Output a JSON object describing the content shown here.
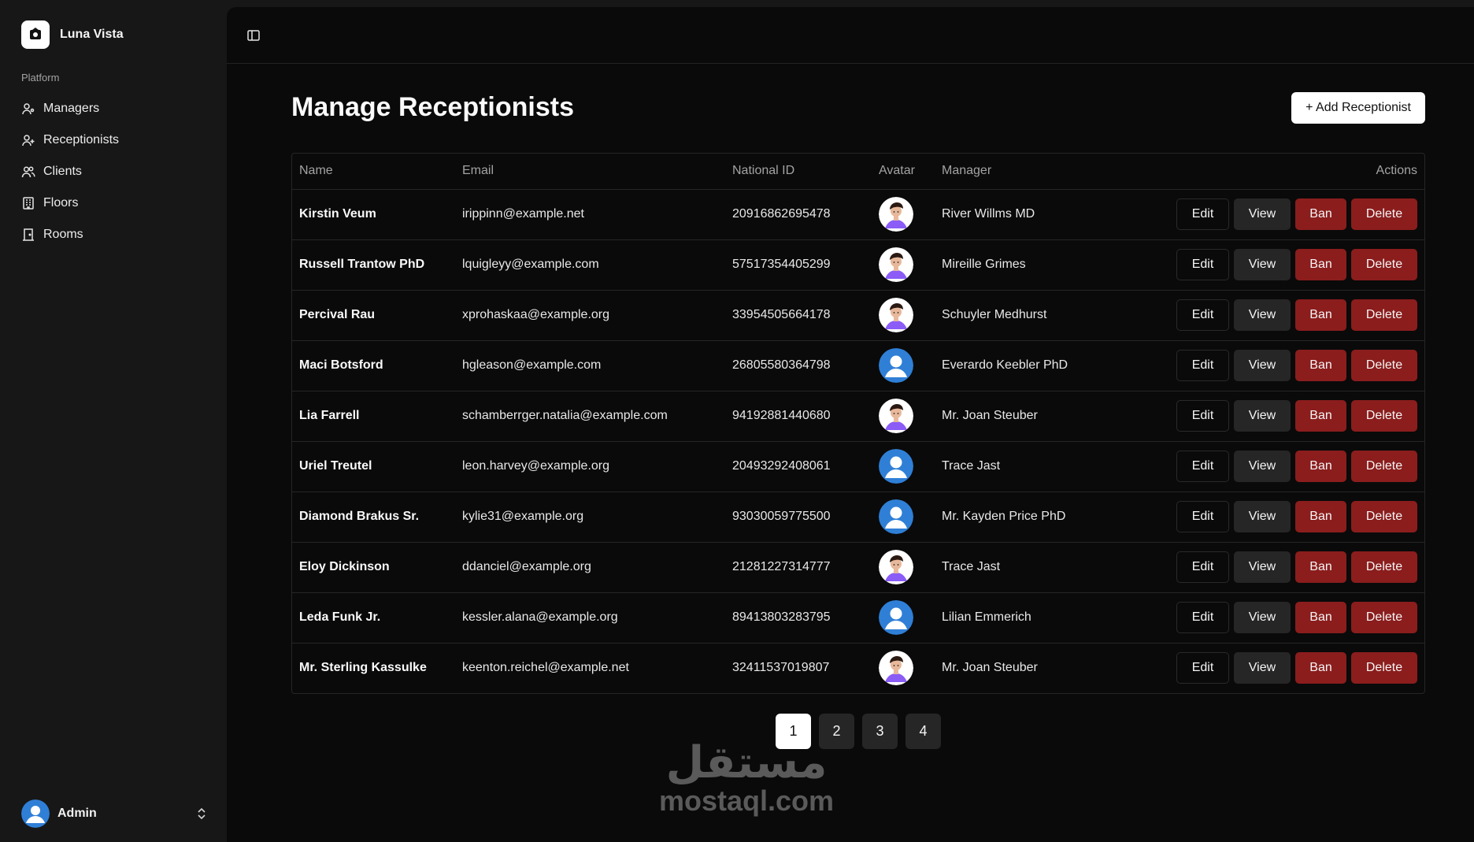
{
  "brand": {
    "name": "Luna Vista"
  },
  "sidebar": {
    "section_label": "Platform",
    "items": [
      {
        "label": "Managers",
        "icon": "user-icon"
      },
      {
        "label": "Receptionists",
        "icon": "user-plus-icon"
      },
      {
        "label": "Clients",
        "icon": "users-icon"
      },
      {
        "label": "Floors",
        "icon": "building-icon"
      },
      {
        "label": "Rooms",
        "icon": "door-icon"
      }
    ],
    "user": {
      "name": "Admin"
    }
  },
  "main": {
    "title": "Manage Receptionists",
    "add_button": "+ Add Receptionist",
    "columns": [
      "Name",
      "Email",
      "National ID",
      "Avatar",
      "Manager",
      "Actions"
    ],
    "actions": {
      "edit": "Edit",
      "view": "View",
      "ban": "Ban",
      "delete": "Delete"
    },
    "rows": [
      {
        "name": "Kirstin Veum",
        "email": "irippinn@example.net",
        "national_id": "20916862695478",
        "avatar": "cartoon",
        "manager": "River Willms MD"
      },
      {
        "name": "Russell Trantow PhD",
        "email": "lquigleyy@example.com",
        "national_id": "57517354405299",
        "avatar": "cartoon",
        "manager": "Mireille Grimes"
      },
      {
        "name": "Percival Rau",
        "email": "xprohaskaa@example.org",
        "national_id": "33954505664178",
        "avatar": "cartoon",
        "manager": "Schuyler Medhurst"
      },
      {
        "name": "Maci Botsford",
        "email": "hgleason@example.com",
        "national_id": "26805580364798",
        "avatar": "default",
        "manager": "Everardo Keebler PhD"
      },
      {
        "name": "Lia Farrell",
        "email": "schamberrger.natalia@example.com",
        "national_id": "94192881440680",
        "avatar": "cartoon",
        "manager": "Mr. Joan Steuber"
      },
      {
        "name": "Uriel Treutel",
        "email": "leon.harvey@example.org",
        "national_id": "20493292408061",
        "avatar": "default",
        "manager": "Trace Jast"
      },
      {
        "name": "Diamond Brakus Sr.",
        "email": "kylie31@example.org",
        "national_id": "93030059775500",
        "avatar": "default",
        "manager": "Mr. Kayden Price PhD"
      },
      {
        "name": "Eloy Dickinson",
        "email": "ddanciel@example.org",
        "national_id": "21281227314777",
        "avatar": "cartoon",
        "manager": "Trace Jast"
      },
      {
        "name": "Leda Funk Jr.",
        "email": "kessler.alana@example.org",
        "national_id": "89413803283795",
        "avatar": "default",
        "manager": "Lilian Emmerich"
      },
      {
        "name": "Mr. Sterling Kassulke",
        "email": "keenton.reichel@example.net",
        "national_id": "32411537019807",
        "avatar": "cartoon",
        "manager": "Mr. Joan Steuber"
      }
    ]
  },
  "pagination": {
    "pages": [
      "1",
      "2",
      "3",
      "4"
    ],
    "current": "1"
  },
  "watermark": {
    "arabic": "مستقل",
    "latin": "mostaql.com"
  },
  "colors": {
    "danger": "#8b1d1d",
    "avatar_blue": "#2f7fd6",
    "avatar_purple": "#8b5cf6"
  }
}
